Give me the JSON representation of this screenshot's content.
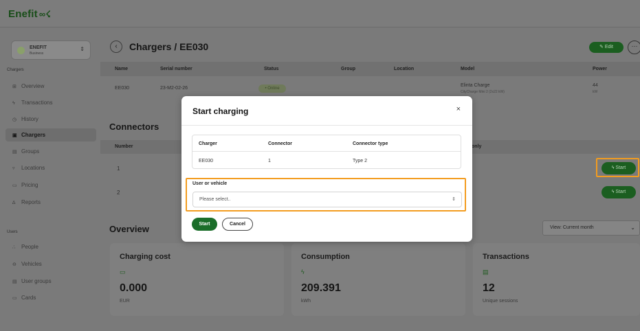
{
  "brand": {
    "name": "Enefit",
    "mark": "∞☇"
  },
  "org": {
    "name": "ENEFIT",
    "type": "Business"
  },
  "sidebar": {
    "chargers_section": "Chargers",
    "items": [
      {
        "icon": "grid-icon",
        "glyph": "⊞",
        "label": "Overview"
      },
      {
        "icon": "bolt-icon",
        "glyph": "ϟ",
        "label": "Transactions"
      },
      {
        "icon": "clock-icon",
        "glyph": "◷",
        "label": "History"
      },
      {
        "icon": "charger-icon",
        "glyph": "▣",
        "label": "Chargers"
      },
      {
        "icon": "groups-icon",
        "glyph": "▤",
        "label": "Groups"
      },
      {
        "icon": "location-icon",
        "glyph": "▿",
        "label": "Locations"
      },
      {
        "icon": "pricing-icon",
        "glyph": "▭",
        "label": "Pricing"
      },
      {
        "icon": "reports-icon",
        "glyph": "∆",
        "label": "Reports"
      }
    ],
    "users_section": "Users",
    "user_items": [
      {
        "icon": "people-icon",
        "glyph": "∴",
        "label": "People"
      },
      {
        "icon": "vehicle-icon",
        "glyph": "⊖",
        "label": "Vehicles"
      },
      {
        "icon": "user-groups-icon",
        "glyph": "▤",
        "label": "User groups"
      },
      {
        "icon": "cards-icon",
        "glyph": "▭",
        "label": "Cards"
      }
    ]
  },
  "header": {
    "title": "Chargers / EE030",
    "edit_label": "Edit",
    "more_label": "···"
  },
  "charger_table": {
    "columns": [
      "Name",
      "Serial number",
      "Status",
      "Group",
      "Location",
      "Model",
      "Power"
    ],
    "row": {
      "name": "EE030",
      "serial": "23-M2-02-26",
      "status": "• Online",
      "model": "Elinta Charge",
      "model_sub": "CityCharge Mini 2 (2x22 kW)",
      "power": "44",
      "power_unit": "kW"
    }
  },
  "connectors": {
    "title": "Connectors",
    "columns": [
      "Number",
      "only"
    ],
    "rows": [
      {
        "number": "1",
        "start_label": "ϟ Start"
      },
      {
        "number": "2",
        "start_label": "ϟ Start"
      }
    ]
  },
  "overview": {
    "title": "Overview",
    "view_select": "View: Current month",
    "cards": [
      {
        "title": "Charging cost",
        "icon": "wallet-icon",
        "glyph": "▭",
        "value": "0.000",
        "unit": "EUR"
      },
      {
        "title": "Consumption",
        "icon": "bolt-icon",
        "glyph": "ϟ",
        "value": "209.391",
        "unit": "kWh"
      },
      {
        "title": "Transactions",
        "icon": "receipt-icon",
        "glyph": "▤",
        "value": "12",
        "unit": "Unique sessions"
      }
    ]
  },
  "modal": {
    "title": "Start charging",
    "close": "×",
    "table": {
      "headers": [
        "Charger",
        "Connector",
        "Connector type"
      ],
      "values": [
        "EE030",
        "1",
        "Type 2"
      ]
    },
    "field_label": "User or vehicle",
    "select_value": "Please select..",
    "select_chevron": "⇕",
    "start_label": "Start",
    "cancel_label": "Cancel"
  },
  "colors": {
    "accent": "#1b6e2a",
    "highlight": "#f39c1f",
    "overlay": "#7a7a7a"
  }
}
